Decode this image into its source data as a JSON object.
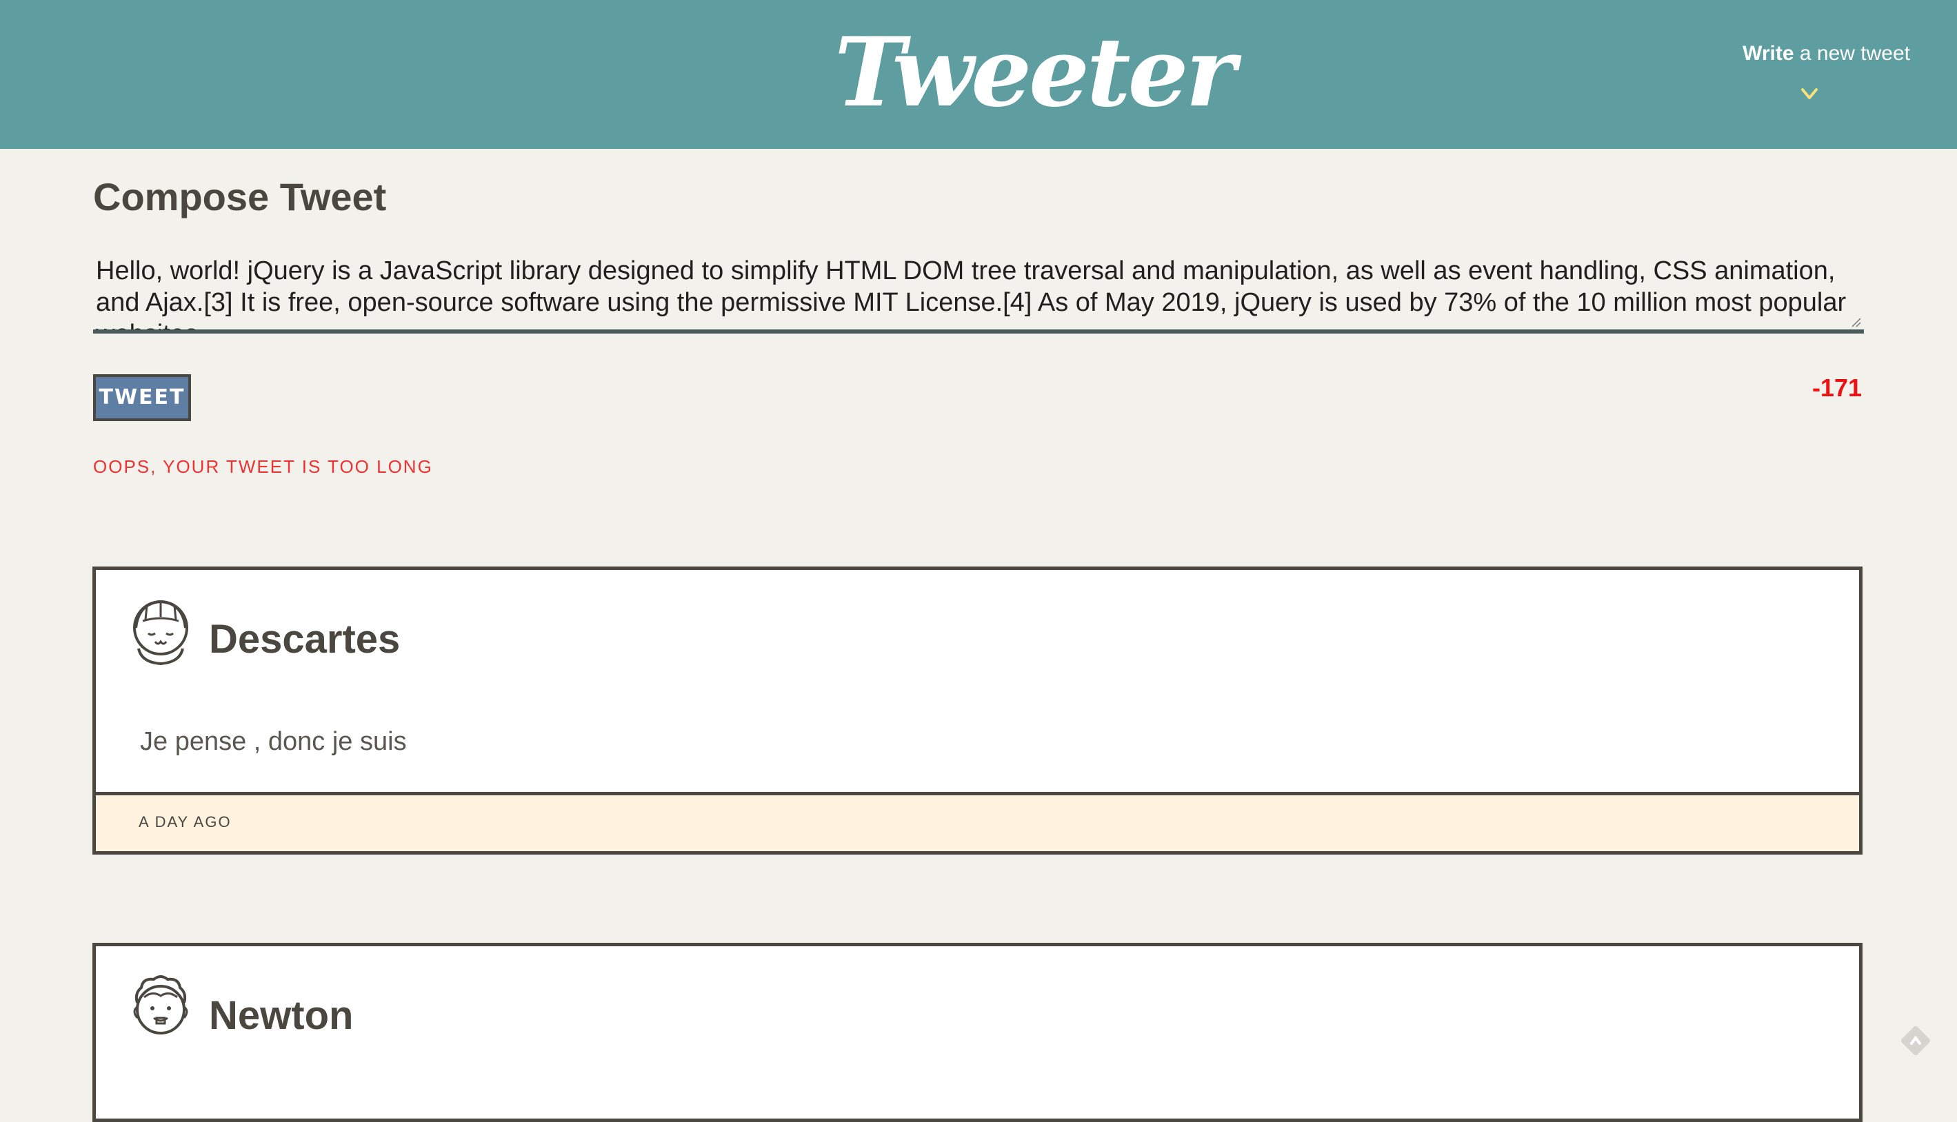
{
  "nav": {
    "logo": "Tweeter",
    "write_bold": "Write",
    "write_rest": " a new tweet"
  },
  "compose": {
    "title": "Compose Tweet",
    "text": "Hello, world! jQuery is a JavaScript library designed to simplify HTML DOM tree traversal and manipulation, as well as event handling, CSS animation, and Ajax.[3] It is free, open-source software using the permissive MIT License.[4] As of May 2019, jQuery is used by 73% of the 10 million most popular websites.",
    "button_label": "TWEET",
    "counter": "-171",
    "error": "OOPS, YOUR TWEET IS TOO LONG"
  },
  "tweets": [
    {
      "author": "Descartes",
      "content": "Je pense , donc je suis",
      "time": "A DAY AGO"
    },
    {
      "author": "Newton"
    }
  ],
  "colors": {
    "header": "#5f9ea0",
    "background": "#f2f1ec",
    "button": "#5f7ea3",
    "error": "#ee1111",
    "footer": "#fff2df",
    "chevron": "#f5e27a"
  }
}
